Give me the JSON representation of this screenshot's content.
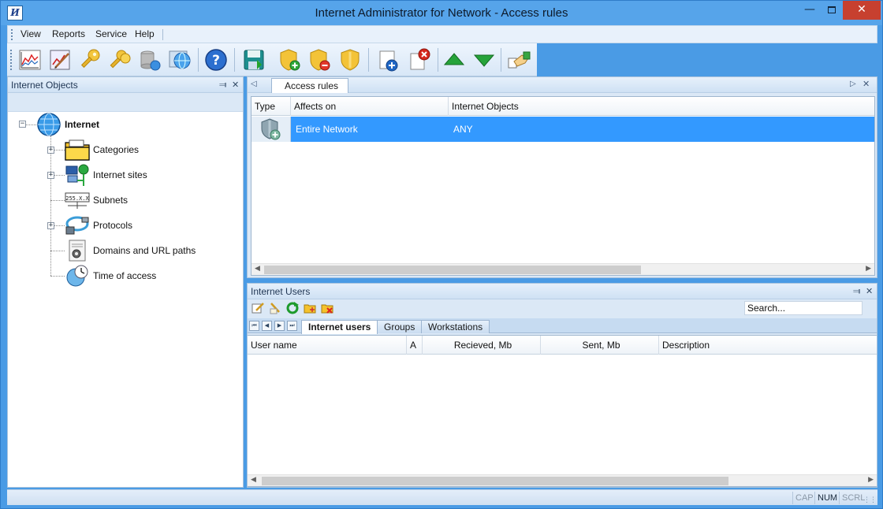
{
  "window": {
    "title": "Internet Administrator for Network - Access rules",
    "app_icon_text": "И"
  },
  "menu": {
    "items": [
      "View",
      "Reports",
      "Service",
      "Help"
    ]
  },
  "toolbar": {
    "buttons": [
      {
        "name": "traffic-chart-icon"
      },
      {
        "name": "report-edit-icon"
      },
      {
        "name": "key-icon"
      },
      {
        "name": "keys-icon"
      },
      {
        "name": "database-globe-icon"
      },
      {
        "name": "network-globe-icon"
      },
      {
        "name": "help-icon"
      },
      {
        "name": "save-icon"
      },
      {
        "name": "shield-add-icon"
      },
      {
        "name": "shield-remove-icon"
      },
      {
        "name": "shield-icon"
      },
      {
        "name": "new-document-icon"
      },
      {
        "name": "delete-document-icon"
      },
      {
        "name": "move-up-icon"
      },
      {
        "name": "move-down-icon"
      },
      {
        "name": "handshake-icon"
      }
    ]
  },
  "left_pane": {
    "title": "Internet Objects",
    "tree": {
      "root": {
        "label": "Internet",
        "icon": "globe-icon"
      },
      "children": [
        {
          "label": "Categories",
          "icon": "folder-icon",
          "expandable": true
        },
        {
          "label": "Internet sites",
          "icon": "network-sites-icon",
          "expandable": true
        },
        {
          "label": "Subnets",
          "icon": "subnet-icon",
          "expandable": false
        },
        {
          "label": "Protocols",
          "icon": "cable-icon",
          "expandable": true
        },
        {
          "label": "Domains and URL paths",
          "icon": "domain-icon",
          "expandable": false
        },
        {
          "label": "Time of access",
          "icon": "clock-globe-icon",
          "expandable": false
        }
      ]
    }
  },
  "access_rules": {
    "tab_label": "Access rules",
    "columns": [
      "Type",
      "Affects on",
      "Internet Objects"
    ],
    "rows": [
      {
        "type_icon": "shield-allow-icon",
        "affects_on": "Entire Network",
        "internet_objects": "ANY"
      }
    ]
  },
  "users_pane": {
    "title": "Internet Users",
    "search_placeholder": "Search...",
    "tabs": [
      "Internet users",
      "Groups",
      "Workstations"
    ],
    "active_tab": "Internet users",
    "columns": [
      "User name",
      "A",
      "Recieved, Mb",
      "Sent, Mb",
      "Description"
    ],
    "rows": []
  },
  "statusbar": {
    "indicators": [
      {
        "label": "CAP",
        "active": false
      },
      {
        "label": "NUM",
        "active": true
      },
      {
        "label": "SCRL",
        "active": false
      }
    ]
  },
  "colors": {
    "accent": "#3399ff",
    "frame": "#4a9be5",
    "close": "#c7402f"
  }
}
